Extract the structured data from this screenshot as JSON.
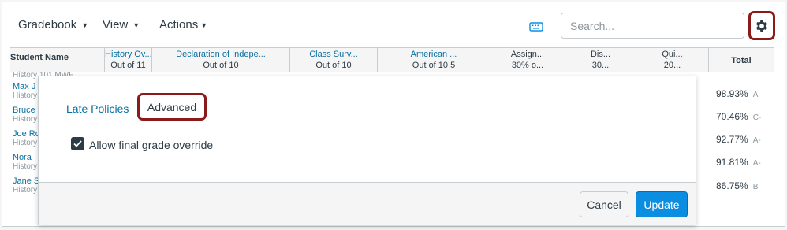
{
  "toolbar": {
    "gradebook_label": "Gradebook",
    "view_label": "View",
    "actions_label": "Actions",
    "search_placeholder": "Search...",
    "keyboard_icon": "keyboard-icon",
    "settings_icon": "gear-icon"
  },
  "grid": {
    "student_header": "Student Name",
    "columns": [
      {
        "title": "History Ov...",
        "sub": "Out of 11"
      },
      {
        "title": "Declaration of Indepe...",
        "sub": "Out of 10"
      },
      {
        "title": "Class Surv...",
        "sub": "Out of 10"
      },
      {
        "title": "American ...",
        "sub": "Out of 10.5"
      },
      {
        "title": "Assign...",
        "sub": "30% o..."
      },
      {
        "title": "Dis...",
        "sub": "30..."
      },
      {
        "title": "Qui...",
        "sub": "20..."
      },
      {
        "title": "Total",
        "sub": ""
      }
    ],
    "rows": [
      {
        "name": "",
        "section": "History 101 MWF",
        "total": "",
        "grade": ""
      },
      {
        "name": "Max J",
        "section": "History",
        "total": "98.93%",
        "grade": "A"
      },
      {
        "name": "Bruce",
        "section": "History",
        "total": "70.46%",
        "grade": "C-"
      },
      {
        "name": "Joe Ro",
        "section": "History",
        "total": "92.77%",
        "grade": "A-"
      },
      {
        "name": "Nora",
        "section": "History",
        "total": "91.81%",
        "grade": "A-"
      },
      {
        "name": "Jane S",
        "section": "History",
        "total": "86.75%",
        "grade": "B"
      }
    ]
  },
  "dialog": {
    "tab_late": "Late Policies",
    "tab_advanced": "Advanced",
    "checkbox_label": "Allow final grade override",
    "checkbox_checked": true,
    "cancel_label": "Cancel",
    "update_label": "Update"
  },
  "colors": {
    "accent": "#0770a3",
    "primary_button": "#0b8ee2",
    "highlight_box": "#8b1a1a"
  }
}
